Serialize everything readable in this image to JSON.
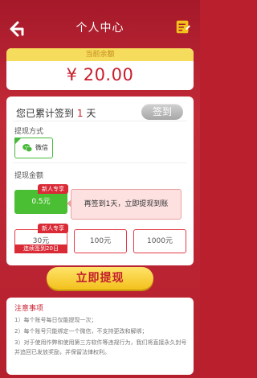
{
  "header": {
    "title": "个人中心",
    "back_icon": "back-arrow-icon",
    "edit_icon": "edit-note-icon"
  },
  "balance": {
    "label": "当前余额",
    "amount": "¥ 20.00"
  },
  "signin": {
    "prefix": "您已累计签到",
    "days": "1",
    "suffix": "天",
    "button_label": "签到"
  },
  "withdraw_method": {
    "label": "提现方式",
    "options": [
      {
        "label": "微信",
        "selected": true,
        "icon": "wechat-icon"
      }
    ]
  },
  "withdraw_amount": {
    "label": "提现金额",
    "options": [
      {
        "value": "0.5元",
        "badge": "新人专享",
        "selected": true
      },
      {
        "value": "30元",
        "badge": "新人专享",
        "ribbon": "连续签到20日"
      },
      {
        "value": "100元"
      },
      {
        "value": "1000元"
      }
    ],
    "tooltip": "再签到1天，立即提现到账"
  },
  "action": {
    "withdraw_label": "立即提现"
  },
  "notes": {
    "title": "注意事项",
    "items": [
      "1）每个账号每日仅能提现一次；",
      "2）每个账号只能绑定一个微信，不支持更改和解绑；",
      "3）对于使用作弊和使用第三方软件等违规行为，我们将直接永久封号并追回已发放奖励，并保留法律权利。"
    ]
  },
  "colors": {
    "accent": "#c81e2c",
    "yellow": "#f6dc5d",
    "green": "#4bbf33",
    "background": "#b91f2d"
  }
}
